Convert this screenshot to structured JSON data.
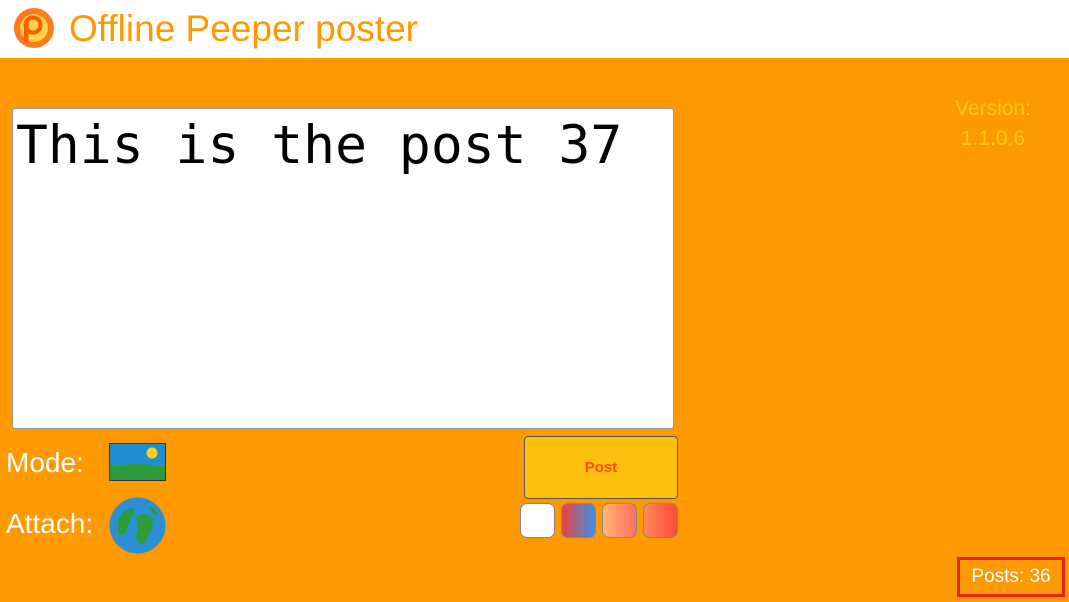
{
  "header": {
    "title": "Offline Peeper poster",
    "logo_icon": "peeper-logo-icon"
  },
  "composer": {
    "post_text": "This is the post 37"
  },
  "version": {
    "label": "Version:",
    "number": "1.1.0.6"
  },
  "controls": {
    "mode_label": "Mode:",
    "mode_icon": "landscape-image-icon",
    "attach_label": "Attach:",
    "attach_icon": "globe-icon",
    "post_button_label": "Post"
  },
  "color_swatches": [
    {
      "name": "white",
      "colors": [
        "#ffffff"
      ]
    },
    {
      "name": "red-blue",
      "colors": [
        "#e8453c",
        "#3f8fe8"
      ]
    },
    {
      "name": "peach-orange",
      "colors": [
        "#ffb673",
        "#ff6f61"
      ]
    },
    {
      "name": "orange-red",
      "colors": [
        "#ff8a5c",
        "#ff4a3a"
      ]
    }
  ],
  "footer": {
    "posts_count": "Posts: 36"
  },
  "theme": {
    "accent": "#ff9900",
    "version_text": "#ffcc00",
    "post_button_bg": "#ffbf0e",
    "post_button_text": "#ff4d00",
    "counter_border": "#e8202a"
  }
}
